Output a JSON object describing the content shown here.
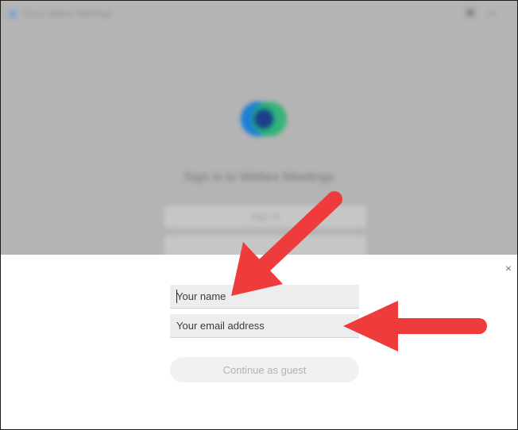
{
  "background_app": {
    "window_title": "Cisco Webex Meetings",
    "sign_in_heading": "Sign in to Webex Meetings",
    "sign_in_button": "Sign In"
  },
  "dialog": {
    "close_glyph": "×",
    "name_placeholder": "Your name",
    "email_placeholder": "Your email address",
    "continue_label": "Continue as guest"
  },
  "colors": {
    "overlay_gray": "#b4b4b4",
    "arrow_red": "#ef3b3b",
    "field_bg": "#ededed"
  },
  "icons": [
    "app-icon",
    "webex-logo-icon",
    "close-icon"
  ]
}
